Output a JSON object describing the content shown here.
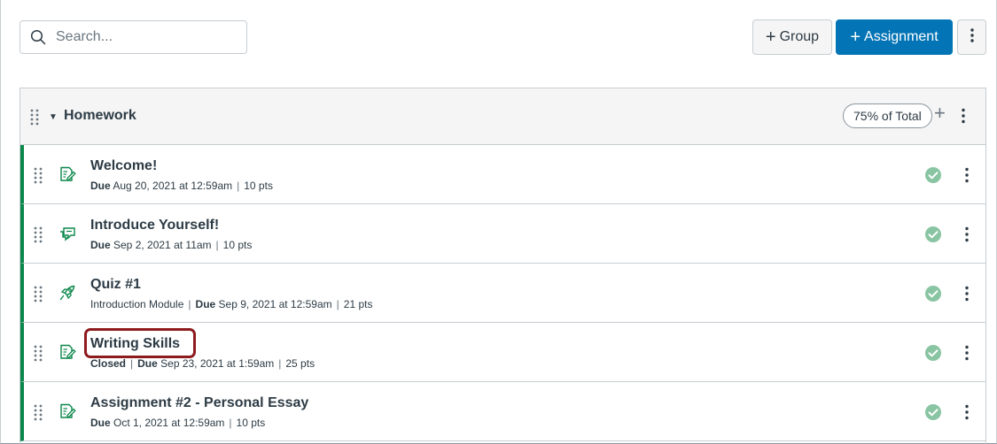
{
  "toolbar": {
    "search_placeholder": "Search...",
    "group_button": "Group",
    "assignment_button": "Assignment",
    "plus_glyph": "+",
    "search_icon": "search-icon",
    "more_icon": "kebab-icon"
  },
  "group": {
    "title": "Homework",
    "weight": "75% of Total",
    "add_glyph": "+",
    "caret": "▼"
  },
  "assignments": [
    {
      "title": "Welcome!",
      "icon": "assignment-icon",
      "meta": [
        {
          "bold": "Due",
          "text": " Aug 20, 2021 at 12:59am"
        },
        {
          "bold": "",
          "text": "10 pts"
        }
      ]
    },
    {
      "title": "Introduce Yourself!",
      "icon": "discussion-icon",
      "meta": [
        {
          "bold": "Due",
          "text": " Sep 2, 2021 at 11am"
        },
        {
          "bold": "",
          "text": "10 pts"
        }
      ]
    },
    {
      "title": "Quiz #1",
      "icon": "quiz-icon",
      "meta": [
        {
          "bold": "",
          "text": "Introduction Module"
        },
        {
          "bold": "Due",
          "text": " Sep 9, 2021 at 12:59am"
        },
        {
          "bold": "",
          "text": "21 pts"
        }
      ]
    },
    {
      "title": "Writing Skills",
      "icon": "assignment-icon",
      "meta": [
        {
          "bold": "Closed",
          "text": ""
        },
        {
          "bold": "Due",
          "text": " Sep 23, 2021 at 1:59am"
        },
        {
          "bold": "",
          "text": "25 pts"
        }
      ]
    },
    {
      "title": "Assignment #2 - Personal Essay",
      "icon": "assignment-icon",
      "meta": [
        {
          "bold": "Due",
          "text": " Oct 1, 2021 at 12:59am"
        },
        {
          "bold": "",
          "text": "10 pts"
        }
      ]
    }
  ],
  "colors": {
    "accent": "#0374b5",
    "published": "#0b874b",
    "status_check": "#89c5a2",
    "highlight": "#8d1b1e"
  }
}
